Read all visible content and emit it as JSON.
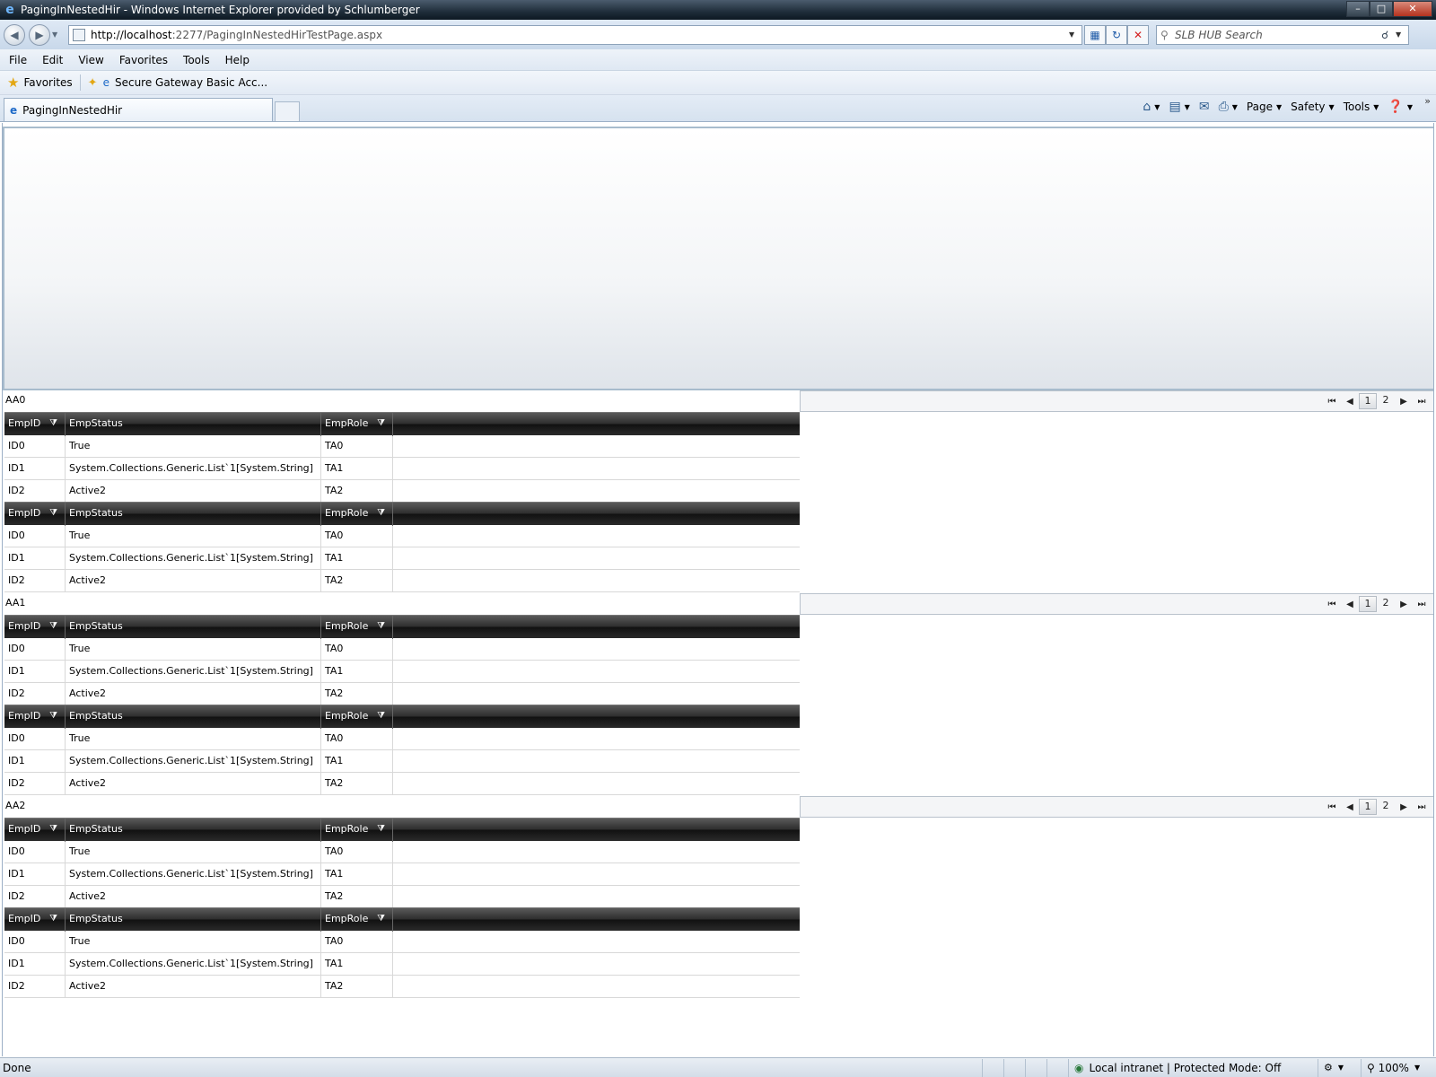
{
  "window": {
    "title": "PagingInNestedHir - Windows Internet Explorer provided by Schlumberger",
    "minimize": "–",
    "maximize": "□",
    "close": "✕"
  },
  "address_bar": {
    "url_host": "http://localhost",
    "url_rest": ":2277/PagingInNestedHirTestPage.aspx",
    "search_placeholder": "SLB HUB Search"
  },
  "menu": {
    "items": [
      "File",
      "Edit",
      "View",
      "Favorites",
      "Tools",
      "Help"
    ]
  },
  "favorites_bar": {
    "favorites_label": "Favorites",
    "link_label": "Secure Gateway Basic Acc..."
  },
  "tab": {
    "label": "PagingInNestedHir"
  },
  "command_bar": {
    "page": "Page",
    "safety": "Safety",
    "tools": "Tools"
  },
  "grid": {
    "columns": [
      "EmpID",
      "EmpStatus",
      "EmpRole"
    ],
    "groups": [
      {
        "label": "AA0",
        "subtables": [
          [
            [
              "ID0",
              "True",
              "TA0"
            ],
            [
              "ID1",
              "System.Collections.Generic.List`1[System.String]",
              "TA1"
            ],
            [
              "ID2",
              "Active2",
              "TA2"
            ]
          ],
          [
            [
              "ID0",
              "True",
              "TA0"
            ],
            [
              "ID1",
              "System.Collections.Generic.List`1[System.String]",
              "TA1"
            ],
            [
              "ID2",
              "Active2",
              "TA2"
            ]
          ]
        ]
      },
      {
        "label": "AA1",
        "subtables": [
          [
            [
              "ID0",
              "True",
              "TA0"
            ],
            [
              "ID1",
              "System.Collections.Generic.List`1[System.String]",
              "TA1"
            ],
            [
              "ID2",
              "Active2",
              "TA2"
            ]
          ],
          [
            [
              "ID0",
              "True",
              "TA0"
            ],
            [
              "ID1",
              "System.Collections.Generic.List`1[System.String]",
              "TA1"
            ],
            [
              "ID2",
              "Active2",
              "TA2"
            ]
          ]
        ]
      },
      {
        "label": "AA2",
        "subtables": [
          [
            [
              "ID0",
              "True",
              "TA0"
            ],
            [
              "ID1",
              "System.Collections.Generic.List`1[System.String]",
              "TA1"
            ],
            [
              "ID2",
              "Active2",
              "TA2"
            ]
          ],
          [
            [
              "ID0",
              "True",
              "TA0"
            ],
            [
              "ID1",
              "System.Collections.Generic.List`1[System.String]",
              "TA1"
            ],
            [
              "ID2",
              "Active2",
              "TA2"
            ]
          ]
        ]
      }
    ]
  },
  "pager": {
    "pages": [
      "1",
      "2"
    ],
    "current": "1"
  },
  "status_bar": {
    "status": "Done",
    "zone": "Local intranet | Protected Mode: Off",
    "zoom": "100%"
  }
}
